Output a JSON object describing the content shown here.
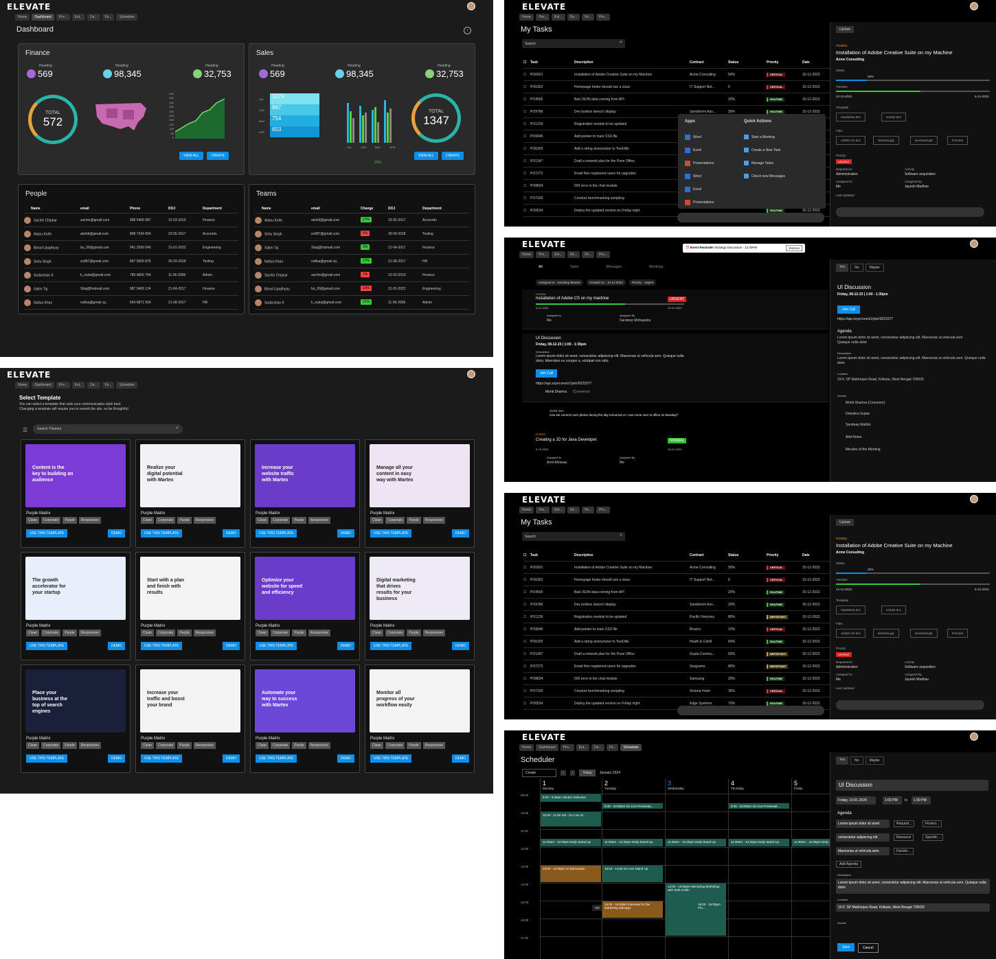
{
  "app": {
    "logo": "ELEVATE"
  },
  "tabs_full": [
    "Home",
    "Dashboard",
    "Pro...",
    "Est...",
    "De...",
    "Fir...",
    "Scheduler"
  ],
  "tabs_tasks": [
    "Home",
    "Pro...",
    "Est...",
    "De...",
    "Fir...",
    "Pro..."
  ],
  "dashboard": {
    "title": "Dashboard",
    "finance": {
      "title": "Finance",
      "stats": [
        {
          "label": "Heading",
          "value": "569"
        },
        {
          "label": "Heading",
          "value": "98,345"
        },
        {
          "label": "Heading",
          "value": "32,753"
        }
      ],
      "total_label": "TOTAL",
      "total": "572",
      "y_ticks": [
        "500",
        "450",
        "400",
        "350",
        "300",
        "250",
        "200",
        "150",
        "100",
        "50",
        "0"
      ]
    },
    "sales": {
      "title": "Sales",
      "stats": [
        {
          "label": "Heading",
          "value": "569"
        },
        {
          "label": "Heading",
          "value": "98,345"
        },
        {
          "label": "Heading",
          "value": "32,753"
        }
      ],
      "total_label": "TOTAL",
      "total": "1347",
      "funnel": [
        {
          "m": "JUL",
          "v": "1274"
        },
        {
          "m": "JUN",
          "v": "867"
        },
        {
          "m": "MAY",
          "v": "754"
        },
        {
          "m": "APR",
          "v": "653"
        }
      ],
      "bar_months": [
        "JUL",
        "JUN",
        "MAY",
        "APR"
      ],
      "pct": "20%"
    },
    "view_all": "VIEW ALL",
    "create": "CREATE",
    "people": {
      "title": "People",
      "cols": [
        "Name",
        "email",
        "Phone",
        "DOJ",
        "Department"
      ],
      "rows": [
        [
          "Sachin Chipkar",
          "sachin@gmail.com",
          "998 5468 987",
          "12-03-2019",
          "Finance"
        ],
        [
          "Atanu Kohli",
          "akohli@gmail.com",
          "898 7234 654",
          "23-05-2017",
          "Accounts"
        ],
        [
          "Binod Upadhyay",
          "bu_09@gmail.com",
          "941 2590 546",
          "31-01-2022",
          "Engineering"
        ],
        [
          "Sintu Singh",
          "ss987@gmail.com",
          "897 5656 876",
          "26-09-2018",
          "Testing"
        ],
        [
          "Sudarshan K",
          "k_suda@gmail.com",
          "789 4656 764",
          "11-06-2009",
          "Admin"
        ],
        [
          "Salim Taj",
          "Sbaj@hotmail.com",
          "987 5468 124",
          "21-04-2017",
          "Finance"
        ],
        [
          "Nafisa Khan",
          "nafisa@gmail.cp,",
          "654 9871 564",
          "21-08-2017",
          "HR"
        ]
      ]
    },
    "teams": {
      "title": "Teams",
      "cols": [
        "Name",
        "email",
        "Change",
        "DOJ",
        "Department"
      ],
      "rows": [
        [
          "Atanu Kohli",
          "akohli@gmail.com",
          "17%",
          "23-05-2017",
          "Accounts",
          "g"
        ],
        [
          "Sintu Singh",
          "ss987@gmail.com",
          "5%",
          "26-09-2018",
          "Testing",
          "r"
        ],
        [
          "Salim Taj",
          "Sbaj@hotmail.com",
          "9%",
          "21-04-2017",
          "Finance",
          "g"
        ],
        [
          "Nafisa Khan",
          "nafisa@gmail.cp,",
          "17%",
          "21-08-2017",
          "HR",
          "g"
        ],
        [
          "Sachin Chipkar",
          "sachin@gmail.com",
          "7%",
          "12-03-2019",
          "Finance",
          "r"
        ],
        [
          "Binod Upadhyay",
          "bu_09@gmail.com",
          "12%",
          "31-01-2022",
          "Engineering",
          "r"
        ],
        [
          "Sudarshan K",
          "k_suda@gmail.com",
          "21%",
          "11-06-2009",
          "Admin",
          "g"
        ]
      ]
    }
  },
  "templates": {
    "title": "Select Template",
    "desc1": "You can select a template that suits your communication style best.",
    "desc2": "Changing a template will require you to rework the site, so be thoughtful",
    "search_placeholder": "Search Themes",
    "items": [
      {
        "h": "Content is the key to building an audience",
        "c": "#7a3bd6"
      },
      {
        "h": "Realize your digital potential with Martex",
        "c": "#f2f2f6"
      },
      {
        "h": "Increase your website traffic with Martex",
        "c": "#6a3cc9"
      },
      {
        "h": "Manage all your content in easy way with Martex",
        "c": "#efe4f3"
      },
      {
        "h": "The growth accelerator for your startup",
        "c": "#e8eefc"
      },
      {
        "h": "Start with a plan and finish with results",
        "c": "#f4f4f4"
      },
      {
        "h": "Optimize your website for speed and efficiency",
        "c": "#6a3cc9"
      },
      {
        "h": "Digital marketing that drives results for your business",
        "c": "#eeeaf6"
      },
      {
        "h": "Place your business at the top of search engines",
        "c": "#1a1f3a"
      },
      {
        "h": "Increase your traffic and boost your brand",
        "c": "#f3f3f3"
      },
      {
        "h": "Automate your way to success with Martex",
        "c": "#6b48d8"
      },
      {
        "h": "Monitor all progress of your workflow easily",
        "c": "#f3f3f3"
      }
    ],
    "name": "Purple Matrix",
    "tags": [
      "Clean",
      "Corporate",
      "Purple",
      "Responsive"
    ],
    "use": "USE THIS TEMPLATE",
    "demo": "DEMO"
  },
  "tasks": {
    "title": "My Tasks",
    "search": "Search",
    "cols": [
      "Task",
      "Description",
      "Contract",
      "Status",
      "Priority",
      "Date"
    ],
    "rows": [
      [
        "PO0001",
        "Installation of Adobe Creative Suite on my Machine",
        "Acme Consulting",
        "50%",
        "CRITICAL",
        "c",
        "15-12-2023"
      ],
      [
        "PO6352",
        "Homepage footer should use a class",
        "IT Support Net...",
        "0",
        "CRITICAL",
        "c",
        "15-12-2023"
      ],
      [
        "PO4565",
        "Bad JSON data coming from API",
        "",
        "20%",
        "ROUTINE",
        "r",
        "15-12-2023"
      ],
      [
        "PO9786",
        "Dev toolbox doesn't display",
        "Sandstorm Ass...",
        "30%",
        "ROUTINE",
        "r",
        "15-12-2023"
      ],
      [
        "PO1239",
        "Registration module to be updated",
        "Pacific Horizons",
        "80%",
        "IMPORTANT",
        "i",
        "15-12-2023"
      ],
      [
        "PO9946",
        "Add pointer to main CSS file",
        "Brustro",
        "10%",
        "CRITICAL",
        "c",
        "15-12-2023"
      ],
      [
        "PO6325",
        "Add a string anonymizer to TextUtils",
        "Heath & Cahill",
        "60%",
        "ROUTINE",
        "r",
        "15-12-2023"
      ],
      [
        "PO1347",
        "Draft a network plan for the Pune Office",
        "Gupta Constru...",
        "50%",
        "IMPORTANT",
        "i",
        "15-12-2023"
      ],
      [
        "PO7272",
        "Email Non registered users for upgrades",
        "Seagrams",
        "80%",
        "IMPORTANT",
        "i",
        "15-12-2023"
      ],
      [
        "PO8834",
        "500 error in the chat module",
        "Samsung",
        "20%",
        "ROUTINE",
        "r",
        "15-12-2023"
      ],
      [
        "PO7339",
        "Conduct benchmarking sampling",
        "Victoria Hotel",
        "35%",
        "CRITICAL",
        "c",
        "15-12-2023"
      ],
      [
        "PO6534",
        "Deploy the updated version on Friday night",
        "Edge Systems",
        "70%",
        "ROUTINE",
        "r",
        "15-12-2023"
      ]
    ],
    "detail": {
      "update": "Update",
      "id": "PO0001",
      "title": "Installation of Adobe Creative Suite on my Machine",
      "client": "Acme Consulting",
      "status_label": "Status",
      "status": "20%",
      "timeline_label": "Timeline",
      "start": "12-12-2023",
      "end": "5-12-2023",
      "template_label": "Template",
      "templates": [
        "requisition.doc",
        "vendor.doc"
      ],
      "files_label": "Files",
      "files": [
        "Adobe CS.doc",
        "sitevista.jpg",
        "iiversand.ppt",
        "forecast"
      ],
      "priority_label": "Priority",
      "priority": "URGENT",
      "dept_label": "Department",
      "dept": "Administration",
      "activity_label": "Activity",
      "activity": "Software acquisition",
      "assigned_to_label": "Assigned to",
      "assigned_to": "Me",
      "assigned_by_label": "Assigned By",
      "assigned_by": "Jayesh Madhav",
      "updated_label": "Last Updated"
    },
    "apps_menu": {
      "apps": "Apps",
      "quick": "Quick Actions",
      "items": [
        "Word",
        "Excel",
        "Presentations",
        "Word",
        "Excel",
        "Presentations"
      ],
      "actions": [
        "Start a Meeting",
        "Create a New Task",
        "Manage Tasks",
        "Check new Messages"
      ]
    }
  },
  "inbox": {
    "reminder": "Event Reminder",
    "reminder_text": "Strategy Discussion - 12:30PM",
    "dismiss": "Dismiss",
    "tabs": [
      "All",
      "Tasks",
      "Messages",
      "Meetings"
    ],
    "filters": [
      "Assigned to : Sandeep Biswas",
      "Created on : 10-12-2023",
      "Priority : Urgent"
    ],
    "t1": {
      "id": "PO0559",
      "title": "Installation of Adobe CS on my machine",
      "badge": "URGENT",
      "start": "5-12-2023",
      "end": "12-12-2023",
      "to_label": "Assigned to",
      "to": "Me",
      "by_label": "Assigned By",
      "by": "Sandeep Mohapatra"
    },
    "m1": {
      "title": "UI Discussion",
      "time": "Friday, 08-12-23 | 1:00 - 1:30pm",
      "dl": "Description",
      "desc": "Lorem ipsum dolor sit amet, consectetur adipiscing elit. Maecenas ut vehicula sem. Quisque nulla dolor, bibendum eu congue a, volutpat non odio.",
      "join": "Join Call",
      "link": "https://api.zoyel.one/z1/join/9223377",
      "conv": "Mohit Sharma",
      "conv_role": "(Convenor)"
    },
    "msg": {
      "name": "Sumit Sen",
      "text": "Can we connect over phone during the day tomorrow or I can come over to office on Monday?"
    },
    "t2": {
      "id": "PO0001",
      "title": "Creating a JD for Java Developer",
      "badge": "NORMAL",
      "start": "6-12-2023",
      "end": "16-12-2023",
      "to_label": "Assigned to",
      "to": "Amit Ahlawat",
      "by_label": "Assigned By",
      "by": "Me"
    },
    "side": {
      "yes": "Yes",
      "no": "No",
      "maybe": "Maybe",
      "title": "UI Discussion",
      "time": "Friday, 08-12-23 | 1:00 - 1:30pm",
      "join": "Join Call",
      "link": "https://api.zoyel.one/z1/join/9223377",
      "agenda": "Agenda",
      "agenda_text": "Lorem ipsum dolor sit amet, consectetur adipiscing elit. Maecenas ut vehicula sem. Quisque nulla dolor",
      "dl": "Description",
      "desc": "Lorem ipsum dolor sit amet, consectetur adipiscing elit. Maecenas ut vehicula sem. Quisque nulla dolor",
      "ll": "Location",
      "loc": "10-F, SP Mukherjee Road, Kolkata, West Bengal 700026",
      "gl": "Guests",
      "guests": [
        "Mohit Sharma (Convenor)",
        "Debolina Gupta",
        "Sandeep Mallick"
      ],
      "notes": "Add Notes",
      "minutes": "Minutes of the Meeting"
    }
  },
  "scheduler": {
    "title": "Scheduler",
    "create": "Create",
    "today": "Today",
    "month": "January 2024",
    "days": [
      {
        "n": "1",
        "d": "Monday"
      },
      {
        "n": "2",
        "d": "Tuesday"
      },
      {
        "n": "3",
        "d": "Wednesday"
      },
      {
        "n": "4",
        "d": "Thursday"
      },
      {
        "n": "5",
        "d": "Friday"
      }
    ],
    "hours": [
      "09:00",
      "10:00",
      "11:00",
      "12:00",
      "13:00",
      "14:00",
      "15:00",
      "16:00",
      "17:00"
    ],
    "events": [
      "9:00 - 9:30am Vendor Selection",
      "9:30 - 10:00am Go Live Presentat...",
      "9:30 - 10:00am Go Live Presentat...",
      "10:00 - 11:00 AM - Go Live St...",
      "11:30am - 12:30pm Daily Stand Up",
      "13:00 - 14:00pm UI Discussion",
      "13:00 - 14:00 Go Live Stand Up",
      "14:00 - 16:00pm Mentoring Workshop with Seth Godin",
      "15:00 - 16:00pm Interview for the Marketing Manager",
      "15:00 - 16:00pm Pro...",
      "+10"
    ],
    "side": {
      "yes": "Yes",
      "no": "No",
      "maybe": "Maybe",
      "title": "UI Discussion",
      "date": "Friday, 10-01-2024",
      "from": "1:00 PM",
      "to_word": "to",
      "to": "1:30 PM",
      "agenda": "Agenda",
      "items": [
        "Lorem ipsum dolor sit amet",
        "consectetur adipiscing elit",
        "Maecenas ut vehicula sem."
      ],
      "docs": [
        "Requisit...",
        "Financi...",
        "Resource",
        "Specific...",
        "Fanctio..."
      ],
      "add": "Add Agenda",
      "dl": "Description",
      "desc": "Lorem ipsum dolor sit amet, consectetur adipiscing elit. Maecenas ut vehicula sem. Quisque nulla dolor",
      "ll": "Location",
      "loc": "10-F, SP Mukherjee Road, Kolkata, West Bengal 700026",
      "gl": "Guests",
      "save": "Save",
      "cancel": "Cancel"
    }
  }
}
